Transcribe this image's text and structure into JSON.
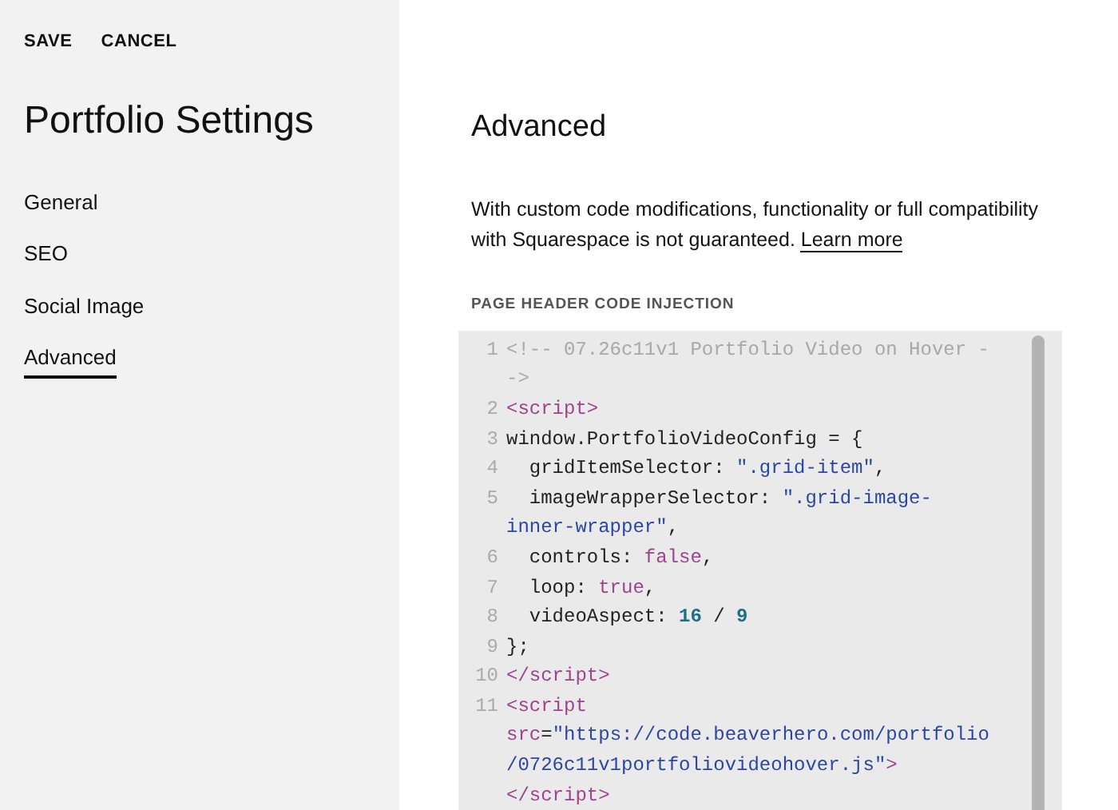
{
  "header_actions": [
    "SAVE",
    "CANCEL"
  ],
  "title": "Portfolio Settings",
  "nav": [
    {
      "label": "General",
      "selected": false
    },
    {
      "label": "SEO",
      "selected": false
    },
    {
      "label": "Social Image",
      "selected": false
    },
    {
      "label": "Advanced",
      "selected": true
    }
  ],
  "section_title": "Advanced",
  "description": "With custom code modifications, functionality or full compatibility with Squarespace is not guaranteed.",
  "learn_more": "Learn more",
  "code_label": "PAGE HEADER CODE INJECTION",
  "code_rows": [
    {
      "number": "1",
      "tokens": [
        {
          "kind": "comment",
          "text": "<!-- 07.26c11v1 Portfolio Video on Hover -"
        }
      ]
    },
    {
      "tokens": [
        {
          "kind": "comment",
          "text": "->"
        }
      ]
    },
    {
      "number": "2",
      "tokens": [
        {
          "kind": "tag",
          "text": "<script>"
        }
      ]
    },
    {
      "number": "3",
      "tokens": [
        {
          "kind": "plain",
          "text": "window.PortfolioVideoConfig = {"
        }
      ]
    },
    {
      "number": "4",
      "tokens": [
        {
          "kind": "plain",
          "text": "  gridItemSelector: "
        },
        {
          "kind": "string",
          "text": "\".grid-item\""
        },
        {
          "kind": "plain",
          "text": ","
        }
      ]
    },
    {
      "number": "5",
      "tokens": [
        {
          "kind": "plain",
          "text": "  imageWrapperSelector: "
        },
        {
          "kind": "string",
          "text": "\".grid-image-"
        }
      ]
    },
    {
      "tokens": [
        {
          "kind": "string",
          "text": "inner-wrapper\""
        },
        {
          "kind": "plain",
          "text": ","
        }
      ]
    },
    {
      "number": "6",
      "tokens": [
        {
          "kind": "plain",
          "text": "  controls: "
        },
        {
          "kind": "keyword",
          "text": "false"
        },
        {
          "kind": "plain",
          "text": ","
        }
      ]
    },
    {
      "number": "7",
      "tokens": [
        {
          "kind": "plain",
          "text": "  loop: "
        },
        {
          "kind": "keyword",
          "text": "true"
        },
        {
          "kind": "plain",
          "text": ","
        }
      ]
    },
    {
      "number": "8",
      "tokens": [
        {
          "kind": "plain",
          "text": "  videoAspect: "
        },
        {
          "kind": "number",
          "text": "16"
        },
        {
          "kind": "plain",
          "text": " / "
        },
        {
          "kind": "number",
          "text": "9"
        }
      ]
    },
    {
      "number": "9",
      "tokens": [
        {
          "kind": "plain",
          "text": "};"
        }
      ]
    },
    {
      "number": "10",
      "tokens": [
        {
          "kind": "tag",
          "text": "</script>"
        }
      ]
    },
    {
      "number": "11",
      "tokens": [
        {
          "kind": "tag",
          "text": "<script"
        }
      ]
    },
    {
      "tokens": [
        {
          "kind": "attr",
          "text": "src"
        },
        {
          "kind": "plain",
          "text": "="
        },
        {
          "kind": "string",
          "text": "\"https://code.beaverhero.com/portfolio"
        }
      ]
    },
    {
      "tokens": [
        {
          "kind": "string",
          "text": "/0726c11v1portfoliovideohover.js\""
        },
        {
          "kind": "tag",
          "text": ">"
        }
      ]
    },
    {
      "tokens": [
        {
          "kind": "tag",
          "text": "</script>"
        }
      ]
    }
  ]
}
